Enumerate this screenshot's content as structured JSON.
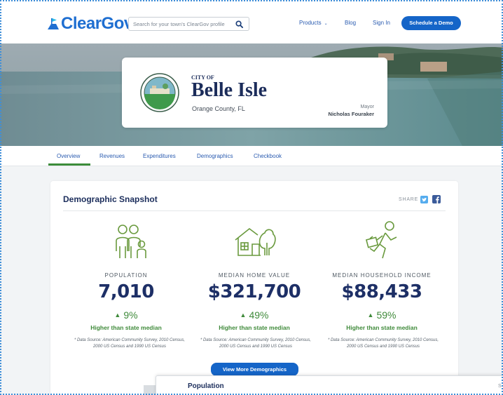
{
  "header": {
    "logo_text": "ClearGov",
    "logo_mark": "™",
    "search_placeholder": "Search for your town's ClearGov profile",
    "search_icon": "search-icon",
    "nav": {
      "products": "Products",
      "blog": "Blog",
      "sign_in": "Sign In",
      "demo": "Schedule a Demo"
    }
  },
  "profile": {
    "city_of": "CITY OF",
    "city_name": "Belle Isle",
    "county": "Orange County, FL",
    "mayor_title": "Mayor",
    "mayor_name": "Nicholas Fouraker"
  },
  "tabs": [
    "Overview",
    "Revenues",
    "Expenditures",
    "Demographics",
    "Checkbook"
  ],
  "active_tab": "Overview",
  "snapshot": {
    "title": "Demographic Snapshot",
    "share_label": "SHARE",
    "stats": [
      {
        "icon": "family-icon",
        "label": "POPULATION",
        "value": "7,010",
        "change": "9%",
        "desc": "Higher than state median",
        "source": "* Data Source: American Community Survey, 2010 Census, 2000 US Census and 1990 US Census"
      },
      {
        "icon": "house-icon",
        "label": "MEDIAN HOME VALUE",
        "value": "$321,700",
        "change": "49%",
        "desc": "Higher than state median",
        "source": "* Data Source: American Community Survey, 2010 Census, 2000 US Census and 1990 US Census"
      },
      {
        "icon": "worker-icon",
        "label": "MEDIAN HOUSEHOLD INCOME",
        "value": "$88,433",
        "change": "59%",
        "desc": "Higher than state median",
        "source": "* Data Source: American Community Survey, 2010 Census, 2000 US Census and 1990 US Census"
      }
    ],
    "more_button": "View More Demographics"
  },
  "population_card": {
    "title": "Population",
    "trailing": "S"
  },
  "colors": {
    "brand_blue": "#1f6fd1",
    "button_blue": "#1565c8",
    "navy": "#1d2f66",
    "green": "#3f8a3a"
  }
}
